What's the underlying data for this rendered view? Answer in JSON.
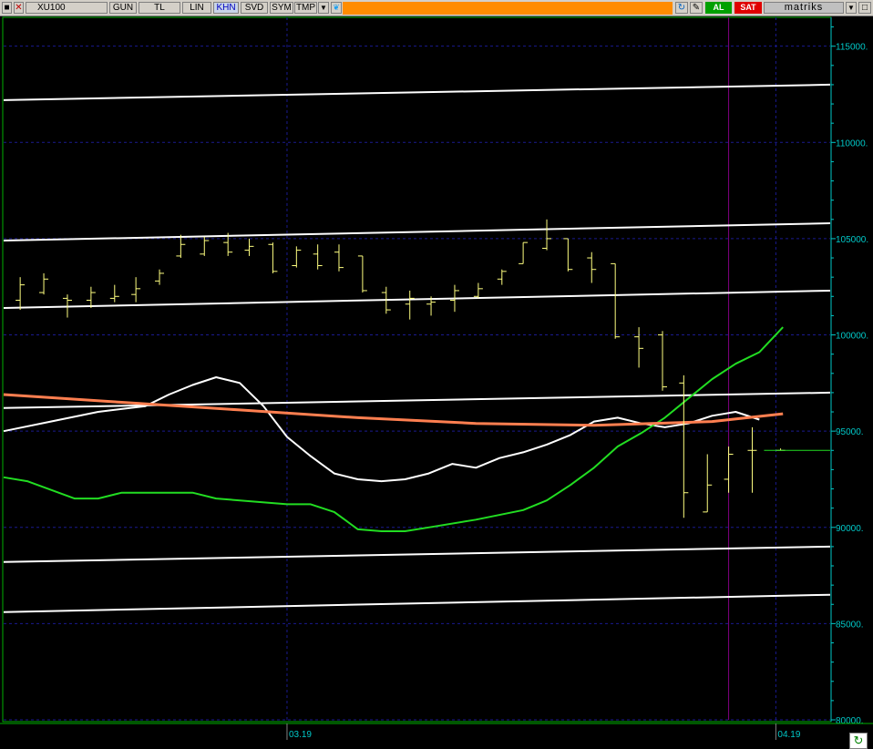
{
  "toolbar": {
    "symbol": "XU100",
    "buttons": [
      "GUN",
      "TL",
      "LIN",
      "KHN",
      "SVD",
      "SYM",
      "TMP"
    ],
    "active_button": "KHN",
    "buy_label": "AL",
    "sell_label": "SAT",
    "brand": "matriks"
  },
  "colors": {
    "background": "#000000",
    "axis": "#00c8c8",
    "price_bars": "#ffff80",
    "white_channel": "#ffffff",
    "white_ma": "#ffffff",
    "green_ma": "#22dd22",
    "orange_ma": "#ff7f50",
    "marker_line": "#800080",
    "grid": "#1a1a90"
  },
  "chart_data": {
    "type": "line",
    "y_axis": {
      "min": 80000,
      "max": 116500,
      "ticks": [
        "115000.",
        "110000.",
        "105000.",
        "100000.",
        "95000.",
        "90000.",
        "85000.",
        "80000."
      ],
      "tick_values": [
        115000,
        110000,
        105000,
        100000,
        95000,
        90000,
        85000,
        80000
      ],
      "side": "right"
    },
    "x_axis": {
      "labels": [
        {
          "text": "03.19",
          "x": 12
        },
        {
          "text": "04.19",
          "x": 32.7
        }
      ],
      "x_min": 0,
      "x_max": 35
    },
    "vertical_marker_x": 30.7,
    "ohlc": [
      {
        "x": 0.7,
        "o": 101800,
        "h": 103000,
        "l": 101300,
        "c": 102600
      },
      {
        "x": 1.7,
        "o": 102200,
        "h": 103200,
        "l": 102100,
        "c": 102900
      },
      {
        "x": 2.7,
        "o": 101900,
        "h": 102100,
        "l": 100900,
        "c": 101800
      },
      {
        "x": 3.7,
        "o": 101800,
        "h": 102500,
        "l": 101400,
        "c": 102200
      },
      {
        "x": 4.7,
        "o": 101900,
        "h": 102600,
        "l": 101700,
        "c": 102000
      },
      {
        "x": 5.6,
        "o": 102100,
        "h": 103000,
        "l": 101700,
        "c": 102400
      },
      {
        "x": 6.6,
        "o": 102800,
        "h": 103400,
        "l": 102600,
        "c": 103200
      },
      {
        "x": 7.5,
        "o": 104100,
        "h": 105200,
        "l": 104000,
        "c": 104700
      },
      {
        "x": 8.5,
        "o": 104200,
        "h": 105100,
        "l": 104100,
        "c": 104900
      },
      {
        "x": 9.5,
        "o": 104800,
        "h": 105300,
        "l": 104100,
        "c": 104300
      },
      {
        "x": 10.4,
        "o": 104400,
        "h": 105000,
        "l": 104100,
        "c": 104600
      },
      {
        "x": 11.4,
        "o": 104700,
        "h": 104800,
        "l": 103200,
        "c": 103300
      },
      {
        "x": 12.4,
        "o": 103600,
        "h": 104600,
        "l": 103500,
        "c": 104400
      },
      {
        "x": 13.3,
        "o": 104200,
        "h": 104700,
        "l": 103400,
        "c": 103600
      },
      {
        "x": 14.2,
        "o": 104300,
        "h": 104700,
        "l": 103300,
        "c": 103500
      },
      {
        "x": 15.2,
        "o": 104100,
        "h": 104100,
        "l": 102200,
        "c": 102300
      },
      {
        "x": 16.2,
        "o": 102200,
        "h": 102500,
        "l": 101100,
        "c": 101300
      },
      {
        "x": 17.2,
        "o": 101600,
        "h": 102300,
        "l": 100800,
        "c": 101900
      },
      {
        "x": 18.1,
        "o": 101600,
        "h": 102000,
        "l": 101000,
        "c": 101700
      },
      {
        "x": 19.1,
        "o": 101800,
        "h": 102600,
        "l": 101200,
        "c": 102300
      },
      {
        "x": 20.1,
        "o": 102000,
        "h": 102700,
        "l": 101900,
        "c": 102400
      },
      {
        "x": 21.1,
        "o": 102900,
        "h": 103400,
        "l": 102600,
        "c": 103300
      },
      {
        "x": 22.0,
        "o": 103700,
        "h": 104800,
        "l": 103700,
        "c": 104800
      },
      {
        "x": 23.0,
        "o": 104500,
        "h": 106000,
        "l": 104400,
        "c": 105000
      },
      {
        "x": 23.9,
        "o": 105000,
        "h": 105000,
        "l": 103300,
        "c": 103400
      },
      {
        "x": 24.9,
        "o": 104000,
        "h": 104300,
        "l": 102700,
        "c": 103400
      },
      {
        "x": 25.9,
        "o": 103700,
        "h": 103700,
        "l": 99800,
        "c": 99900
      },
      {
        "x": 26.9,
        "o": 99900,
        "h": 100400,
        "l": 98300,
        "c": 99300
      },
      {
        "x": 27.9,
        "o": 100000,
        "h": 100200,
        "l": 97100,
        "c": 97300
      },
      {
        "x": 28.8,
        "o": 97500,
        "h": 97900,
        "l": 90500,
        "c": 91800
      },
      {
        "x": 29.8,
        "o": 90800,
        "h": 93800,
        "l": 90800,
        "c": 92200
      },
      {
        "x": 30.7,
        "o": 92500,
        "h": 94200,
        "l": 91800,
        "c": 93800
      },
      {
        "x": 31.7,
        "o": 94000,
        "h": 95200,
        "l": 91800,
        "c": 94000
      },
      {
        "x": 32.9,
        "o": 94000,
        "h": 94100,
        "l": 94000,
        "c": 94000
      }
    ],
    "series": [
      {
        "color": "#ffffff",
        "width": 2,
        "points": [
          [
            0,
            95000
          ],
          [
            2,
            95500
          ],
          [
            4,
            96000
          ],
          [
            6,
            96300
          ],
          [
            7,
            96900
          ],
          [
            8,
            97400
          ],
          [
            9,
            97800
          ],
          [
            10,
            97500
          ],
          [
            11,
            96300
          ],
          [
            12,
            94700
          ],
          [
            13,
            93700
          ],
          [
            14,
            92800
          ],
          [
            15,
            92500
          ],
          [
            16,
            92400
          ],
          [
            17,
            92500
          ],
          [
            18,
            92800
          ],
          [
            19,
            93300
          ],
          [
            20,
            93100
          ],
          [
            21,
            93600
          ],
          [
            22,
            93900
          ],
          [
            23,
            94300
          ],
          [
            24,
            94800
          ],
          [
            25,
            95500
          ],
          [
            26,
            95700
          ],
          [
            27,
            95400
          ],
          [
            28,
            95200
          ],
          [
            29,
            95400
          ],
          [
            30,
            95800
          ],
          [
            31,
            96000
          ],
          [
            32,
            95600
          ]
        ]
      },
      {
        "color": "#22dd22",
        "width": 2,
        "points": [
          [
            0,
            92600
          ],
          [
            1,
            92400
          ],
          [
            3,
            91500
          ],
          [
            4,
            91500
          ],
          [
            5,
            91800
          ],
          [
            8,
            91800
          ],
          [
            9,
            91500
          ],
          [
            12,
            91200
          ],
          [
            13,
            91200
          ],
          [
            14,
            90800
          ],
          [
            15,
            89900
          ],
          [
            16,
            89800
          ],
          [
            17,
            89800
          ],
          [
            18,
            90000
          ],
          [
            20,
            90400
          ],
          [
            22,
            90900
          ],
          [
            23,
            91400
          ],
          [
            24,
            92200
          ],
          [
            25,
            93100
          ],
          [
            26,
            94200
          ],
          [
            27,
            94900
          ],
          [
            28,
            95700
          ],
          [
            29,
            96700
          ],
          [
            30,
            97700
          ],
          [
            31,
            98500
          ],
          [
            32,
            99100
          ],
          [
            33,
            100400
          ]
        ]
      },
      {
        "color": "#ff7f50",
        "width": 3,
        "points": [
          [
            0,
            96900
          ],
          [
            5,
            96500
          ],
          [
            10,
            96100
          ],
          [
            15,
            95700
          ],
          [
            20,
            95400
          ],
          [
            25,
            95300
          ],
          [
            30,
            95500
          ],
          [
            33,
            95900
          ]
        ]
      }
    ],
    "channel_lines": [
      {
        "start": 112200,
        "end": 113000
      },
      {
        "start": 104900,
        "end": 105800
      },
      {
        "start": 101400,
        "end": 102300
      },
      {
        "start": 96200,
        "end": 97000
      },
      {
        "start": 88200,
        "end": 89000
      },
      {
        "start": 85600,
        "end": 86500
      }
    ],
    "last_price": 94000
  }
}
